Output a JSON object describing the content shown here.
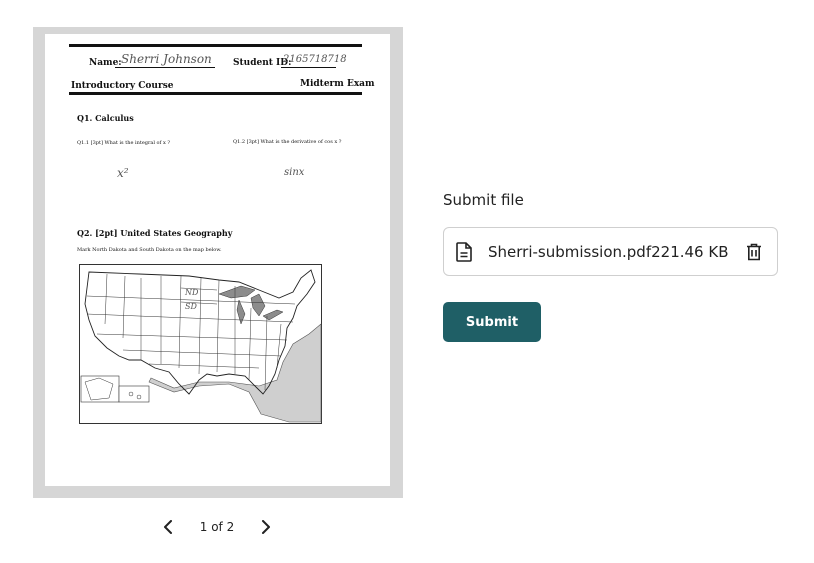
{
  "preview": {
    "exam": {
      "name_label": "Name:",
      "name_value": "Sherri Johnson",
      "student_id_label": "Student ID:",
      "student_id_value": "2165718718",
      "course": "Introductory Course",
      "exam_title": "Midterm Exam",
      "q1_title": "Q1.  Calculus",
      "q1_1": "Q1.1  [3pt]  What is the integral of x ?",
      "q1_2": "Q1.2  [3pt]  What is the derivative of  cos x ?",
      "q1_1_answer": "x²",
      "q1_2_answer": "sinx",
      "q2_title": "Q2.  [2pt] United States Geography",
      "q2_text": "Mark North Dakota and South Dakota on the map below.",
      "map_marks": [
        "ND",
        "SD"
      ]
    },
    "pagination": {
      "current": "1 of 2"
    },
    "icons": {
      "prev": "chevron-left-icon",
      "next": "chevron-right-icon"
    }
  },
  "submission": {
    "label": "Submit file",
    "file_name": "Sherri-submission.pdf",
    "file_size": "221.46 KB",
    "file_icon": "document-icon",
    "delete_icon": "trash-icon",
    "submit_label": "Submit",
    "accent_color": "#1f5f66"
  }
}
